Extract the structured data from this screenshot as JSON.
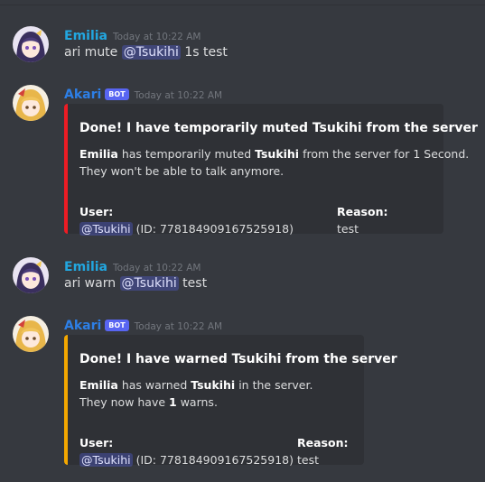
{
  "messages": [
    {
      "author": "Emilia",
      "timestamp": "Today at 10:22 AM",
      "content_prefix": "ari mute ",
      "mention": "@Tsukihi",
      "content_suffix": " 1s test"
    },
    {
      "author": "Akari",
      "bot_tag": "BOT",
      "timestamp": "Today at 10:22 AM",
      "embed": {
        "accent_color": "#ed1c24",
        "title": "Done! I have temporarily muted Tsukihi from the server",
        "desc_actor": "Emilia",
        "desc_mid": " has temporarily muted ",
        "desc_target": "Tsukihi",
        "desc_end": " from the server for 1 Second.",
        "desc_line2": "They won't be able to talk anymore.",
        "user_label": "User:",
        "user_mention": "@Tsukihi",
        "user_id": " (ID: 778184909167525918)",
        "reason_label": "Reason:",
        "reason_value": "test"
      }
    },
    {
      "author": "Emilia",
      "timestamp": "Today at 10:22 AM",
      "content_prefix": "ari warn ",
      "mention": "@Tsukihi",
      "content_suffix": " test"
    },
    {
      "author": "Akari",
      "bot_tag": "BOT",
      "timestamp": "Today at 10:22 AM",
      "embed": {
        "accent_color": "#f4a700",
        "title": "Done! I have warned Tsukihi from the server",
        "desc_actor": "Emilia",
        "desc_mid": " has warned ",
        "desc_target": "Tsukihi",
        "desc_end": " in the server.",
        "desc_line2_prefix": "They now have ",
        "desc_line2_count": "1",
        "desc_line2_suffix": " warns.",
        "user_label": "User:",
        "user_mention": "@Tsukihi",
        "user_id": " (ID: 778184909167525918)",
        "reason_label": "Reason:",
        "reason_value": "test"
      }
    }
  ]
}
